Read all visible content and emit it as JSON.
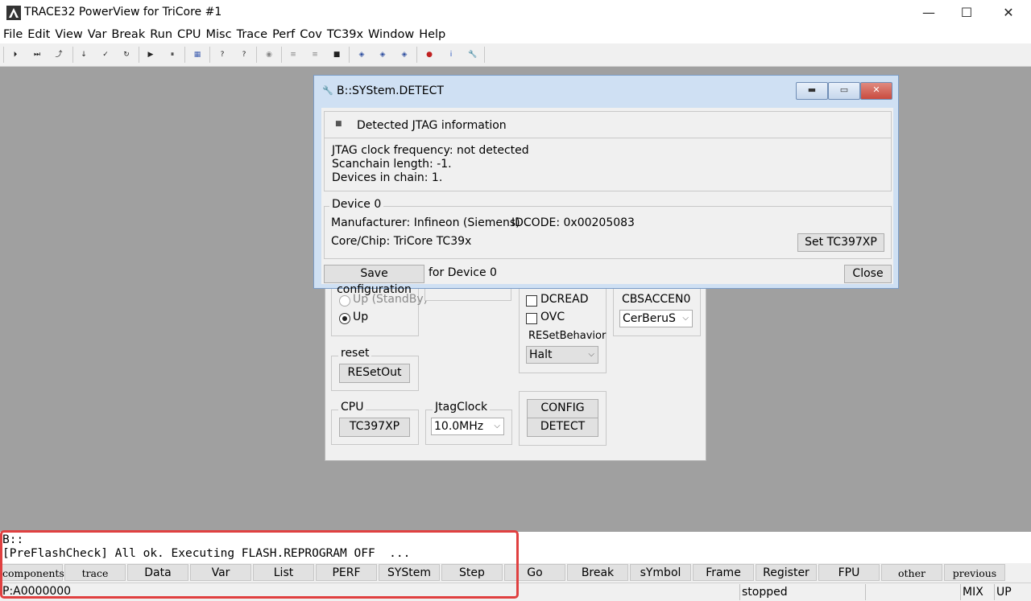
{
  "window": {
    "title": "TRACE32 PowerView for TriCore #1",
    "minimize": "—",
    "maximize": "☐",
    "close": "✕"
  },
  "menu": [
    "File",
    "Edit",
    "View",
    "Var",
    "Break",
    "Run",
    "CPU",
    "Misc",
    "Trace",
    "Perf",
    "Cov",
    "TC39x",
    "Window",
    "Help"
  ],
  "toolbar": {
    "icons": [
      "step-into-icon",
      "step-over-icon",
      "step-up-icon",
      "down-icon",
      "return-icon",
      "up-icon",
      "go-icon",
      "break-icon",
      "list-icon",
      "help-icon",
      "context-help-icon",
      "record-icon",
      "list-source-icon",
      "list-asm-icon",
      "stop-icon",
      "var-watch-icon",
      "var-view-icon",
      "var-local-icon",
      "bug-icon",
      "info-icon",
      "wrench-icon"
    ]
  },
  "bg_panel": {
    "power_up_standby": "Up (StandBy)",
    "power_up": "Up",
    "dcread": "DCREAD",
    "ovc": "OVC",
    "resetbehavior_label": "RESetBehavior",
    "resetbehavior_value": "Halt",
    "cbsaccen_label": "CBSACCEN0",
    "cbsaccen_value": "CerBeruS",
    "reset_label": "reset",
    "reset_button": "RESetOut",
    "cpu_label": "CPU",
    "cpu_button": "TC397XP",
    "jtagclock_label": "JtagClock",
    "jtagclock_value": "10.0MHz",
    "config_button": "CONFIG",
    "detect_button": "DETECT"
  },
  "detect_dialog": {
    "title": "B::SYStem.DETECT",
    "header": "Detected JTAG information",
    "jtag_clock": "JTAG clock frequency: not detected",
    "scanchain": "Scanchain length: -1.",
    "devices": "Devices in chain: 1.",
    "device_label": "Device 0",
    "manufacturer": "Manufacturer: Infineon (Siemens)",
    "idcode": "IDCODE: 0x00205083",
    "core": "Core/Chip: TriCore TC39x",
    "set_button": "Set TC397XP",
    "save_button": "Save configuration",
    "for_device": "for Device 0",
    "close_button": "Close"
  },
  "command": {
    "prompt": "B::",
    "message": "[PreFlashCheck] All ok. Executing FLASH.REPROGRAM OFF  ..."
  },
  "softkeys": [
    "components",
    "trace",
    "Data",
    "Var",
    "List",
    "PERF",
    "SYStem",
    "Step",
    "Go",
    "Break",
    "sYmbol",
    "Frame",
    "Register",
    "FPU",
    "other",
    "previous"
  ],
  "status": {
    "address": "P:A0000000",
    "state": "stopped",
    "mode": "MIX",
    "dir": "UP"
  },
  "colors": {
    "highlight": "#e04040",
    "dialog_frame": "#cfe0f3",
    "close_red": "#c94b3f"
  }
}
